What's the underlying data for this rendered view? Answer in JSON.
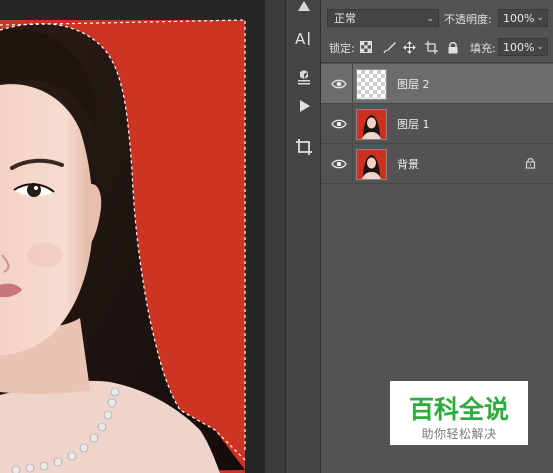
{
  "tools": {
    "items": [
      {
        "name": "3d-tool-icon"
      },
      {
        "name": "character-panel-icon"
      },
      {
        "name": "3d-object-icon"
      },
      {
        "name": "play-action-icon"
      },
      {
        "name": "crop-tool-icon"
      }
    ]
  },
  "layers_panel": {
    "blend_mode": "正常",
    "opacity_label": "不透明度:",
    "opacity_value": "100%",
    "lock_label": "锁定:",
    "fill_label": "填充:",
    "fill_value": "100%",
    "layers": [
      {
        "name": "图层 2",
        "selected": true,
        "thumb": "transparent",
        "locked": false
      },
      {
        "name": "图层 1",
        "selected": false,
        "thumb": "portrait",
        "locked": false
      },
      {
        "name": "背景",
        "selected": false,
        "thumb": "portrait",
        "locked": true
      }
    ]
  },
  "colors": {
    "canvas_red": "#cc3423",
    "selection_green": "#2dab3c"
  },
  "watermark": {
    "title": "百科全说",
    "subtitle": "助你轻松解决"
  }
}
